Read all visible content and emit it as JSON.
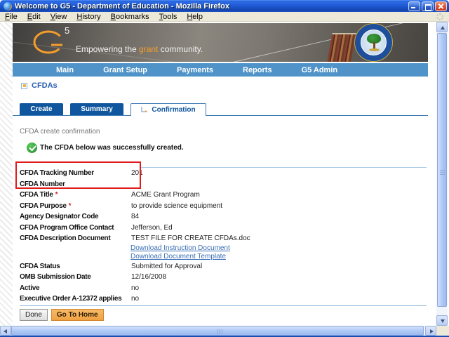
{
  "window": {
    "title": "Welcome to G5 - Department of Education - Mozilla Firefox",
    "menu": [
      "File",
      "Edit",
      "View",
      "History",
      "Bookmarks",
      "Tools",
      "Help"
    ]
  },
  "banner": {
    "logo_letter": "G",
    "logo_sup": "5",
    "tagline_prefix": "Empowering the ",
    "tagline_highlight": "grant",
    "tagline_suffix": " community."
  },
  "nav": {
    "items": [
      "Main",
      "Grant Setup",
      "Payments",
      "Reports",
      "G5 Admin"
    ]
  },
  "page": {
    "breadcrumb": "CFDAs",
    "tabs": {
      "create": "Create",
      "summary": "Summary",
      "confirmation": "Confirmation"
    },
    "heading": "CFDA create confirmation",
    "success_message": "The CFDA below was successfully created.",
    "required_marker": "*",
    "fields": [
      {
        "label": "CFDA Tracking Number",
        "value": "201"
      },
      {
        "label": "CFDA Number",
        "value": ""
      },
      {
        "label": "CFDA Title",
        "value": "ACME Grant Program",
        "required": true
      },
      {
        "label": "CFDA Purpose",
        "value": "to provide science equipment",
        "required": true
      },
      {
        "label": "Agency Designator Code",
        "value": "84"
      },
      {
        "label": "CFDA Program Office Contact",
        "value": "Jefferson, Ed"
      },
      {
        "label": "CFDA Description Document",
        "value": "TEST FILE FOR CREATE CFDAs.doc"
      }
    ],
    "links": [
      {
        "label": "Download Instruction Document"
      },
      {
        "label": "Download Document Template"
      }
    ],
    "fields2": [
      {
        "label": "CFDA Status",
        "value": "Submitted for Approval"
      },
      {
        "label": "OMB Submission Date",
        "value": "12/16/2008"
      },
      {
        "label": "Active",
        "value": "no"
      },
      {
        "label": "Executive Order A-12372 applies",
        "value": "no"
      }
    ],
    "buttons": {
      "done": "Done",
      "go_home": "Go To Home"
    }
  },
  "colors": {
    "accent_orange": "#f59d2c",
    "nav_blue": "#4f93c8",
    "tab_blue": "#10569e",
    "link_blue": "#3a6fb5",
    "highlight_red": "#e01b1b",
    "titlebar_blue": "#1c55cf"
  }
}
